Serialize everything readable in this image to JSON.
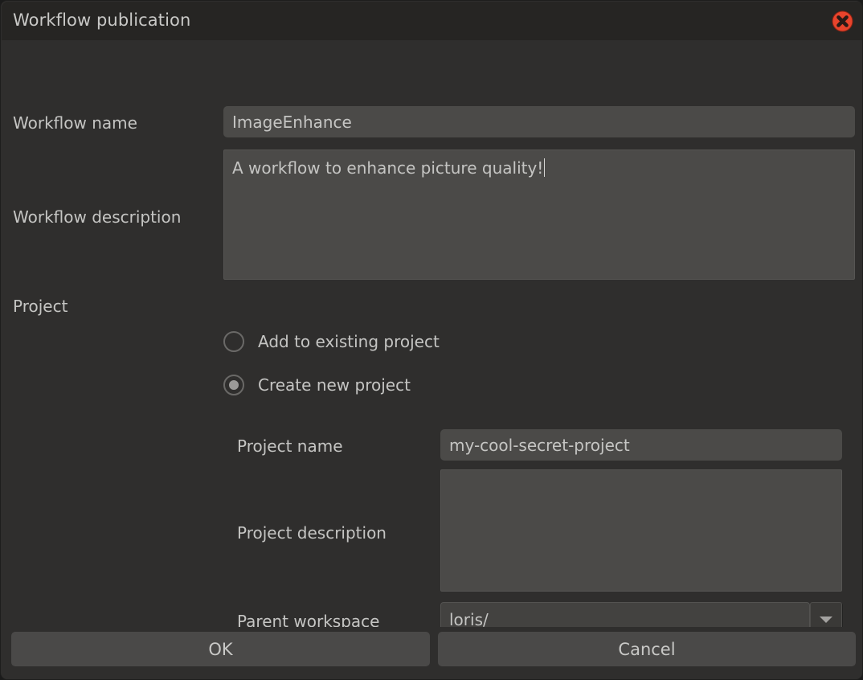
{
  "window": {
    "title": "Workflow publication",
    "close_icon": "close-circle-icon",
    "close_icon_color": "#e8442c"
  },
  "form": {
    "workflow_name": {
      "label": "Workflow name",
      "value": "ImageEnhance",
      "placeholder": ""
    },
    "workflow_description": {
      "label": "Workflow description",
      "value": "A workflow to enhance picture quality!",
      "placeholder": "",
      "caret_visible": true
    },
    "project": {
      "label": "Project",
      "options": [
        {
          "label": "Add to existing project",
          "selected": false
        },
        {
          "label": "Create new project",
          "selected": true
        }
      ]
    },
    "project_name": {
      "label": "Project name",
      "value": "my-cool-secret-project",
      "placeholder": ""
    },
    "project_description": {
      "label": "Project description",
      "value": "",
      "placeholder": ""
    },
    "parent_workspace": {
      "label": "Parent workspace",
      "value": "loris/",
      "placeholder": "",
      "dropdown_icon": "chevron-down-icon"
    }
  },
  "buttons": {
    "ok": "OK",
    "cancel": "Cancel"
  },
  "colors": {
    "dialog_background": "#2f2e2d",
    "titlebar_background": "#262523",
    "field_background": "#4b4a48",
    "button_background": "#4a4948",
    "text": "#c5c5c3",
    "accent_close": "#e8442c"
  }
}
